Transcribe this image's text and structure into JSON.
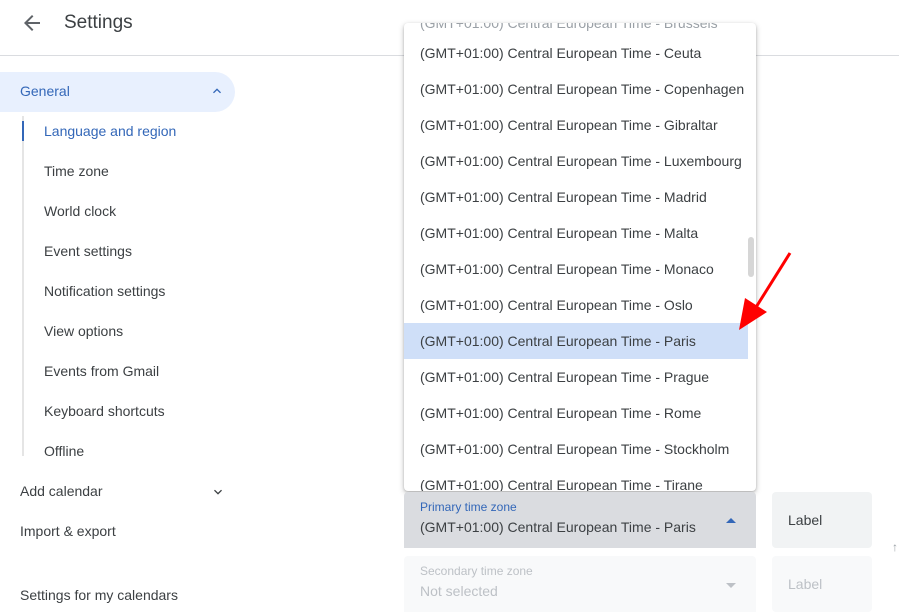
{
  "header": {
    "title": "Settings",
    "back_icon": "arrow-back-icon"
  },
  "sidebar": {
    "general_label": "General",
    "general_expanded": true,
    "sub_items": [
      {
        "label": "Language and region",
        "active": true
      },
      {
        "label": "Time zone"
      },
      {
        "label": "World clock"
      },
      {
        "label": "Event settings"
      },
      {
        "label": "Notification settings"
      },
      {
        "label": "View options"
      },
      {
        "label": "Events from Gmail"
      },
      {
        "label": "Keyboard shortcuts"
      },
      {
        "label": "Offline"
      }
    ],
    "add_calendar": "Add calendar",
    "import_export": "Import & export",
    "settings_for_my_calendars": "Settings for my calendars"
  },
  "timezone_dropdown": {
    "options": [
      "(GMT+01:00) Central European Time - Ceuta",
      "(GMT+01:00) Central European Time - Copenhagen",
      "(GMT+01:00) Central European Time - Gibraltar",
      "(GMT+01:00) Central European Time - Luxembourg",
      "(GMT+01:00) Central European Time - Madrid",
      "(GMT+01:00) Central European Time - Malta",
      "(GMT+01:00) Central European Time - Monaco",
      "(GMT+01:00) Central European Time - Oslo",
      "(GMT+01:00) Central European Time - Paris",
      "(GMT+01:00) Central European Time - Prague",
      "(GMT+01:00) Central European Time - Rome",
      "(GMT+01:00) Central European Time - Stockholm",
      "(GMT+01:00) Central European Time - Tirane"
    ],
    "selected_index": 8
  },
  "primary_time_zone": {
    "label": "Primary time zone",
    "value": "(GMT+01:00) Central European Time - Paris",
    "label_placeholder": "Label"
  },
  "secondary_time_zone": {
    "label": "Secondary time zone",
    "value": "Not selected",
    "label_placeholder": "Label"
  },
  "colors": {
    "accent": "#3367b8",
    "selected_bg": "#cfdff8",
    "annotation": "#ff0000"
  }
}
